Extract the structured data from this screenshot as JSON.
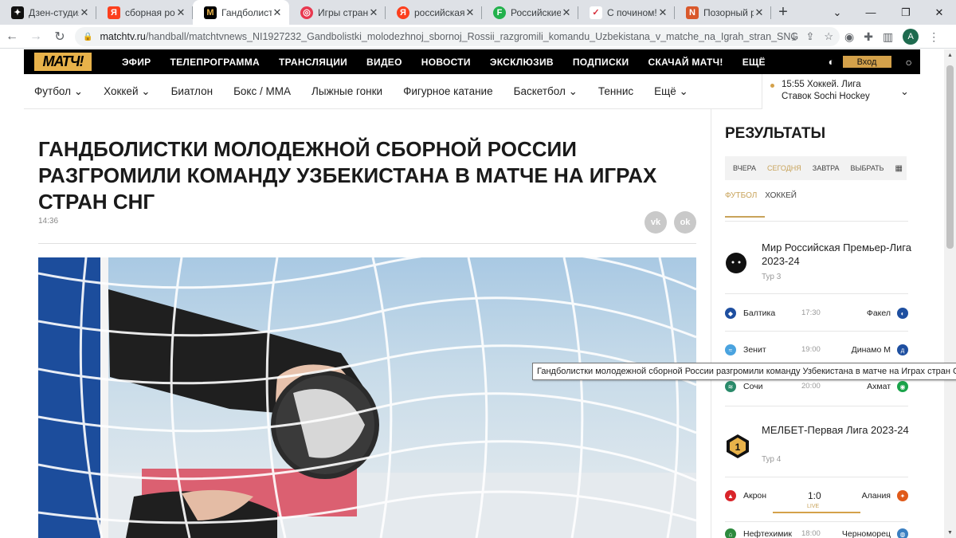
{
  "browser": {
    "tabs": [
      {
        "title": "Дзен-студия",
        "icon": "dzen-icon",
        "color": "#111111"
      },
      {
        "title": "сборная рос",
        "icon": "yandex-icon",
        "color": "#fc3f1d"
      },
      {
        "title": "Гандболистк",
        "icon": "match-tv-icon",
        "color": "#000000",
        "active": true
      },
      {
        "title": "Игры стран С",
        "icon": "sport-site-icon",
        "color": "#e8384f"
      },
      {
        "title": "российская с",
        "icon": "yandex-icon",
        "color": "#fc3f1d"
      },
      {
        "title": "Российские",
        "icon": "f-site-icon",
        "color": "#22b14c"
      },
      {
        "title": "С почином!",
        "icon": "sport-site-icon",
        "color": "#d62d3a"
      },
      {
        "title": "Позорный р",
        "icon": "news-site-icon",
        "color": "#d9582b"
      }
    ],
    "url_host": "matchtv.ru",
    "url_path": "/handball/matchtvnews_NI1927232_Gandbolistki_molodezhnoj_sbornoj_Rossii_razgromili_komandu_Uzbekistana_v_matche_na_Igrah_stran_SNG",
    "profile_initial": "A"
  },
  "site": {
    "logo": "МАТЧ!",
    "nav": [
      "ЭФИР",
      "ТЕЛЕПРОГРАММА",
      "ТРАНСЛЯЦИИ",
      "ВИДЕО",
      "НОВОСТИ",
      "ЭКСКЛЮЗИВ",
      "ПОДПИСКИ",
      "СКАЧАЙ МАТЧ!",
      "ЕЩЁ"
    ],
    "login": "Вход",
    "sports": [
      "Футбол",
      "Хоккей",
      "Биатлон",
      "Бокс / ММА",
      "Лыжные гонки",
      "Фигурное катание",
      "Баскетбол",
      "Теннис",
      "Ещё"
    ],
    "live_line1": "15:55 Хоккей. Лига",
    "live_line2": "Ставок Sochi Hockey"
  },
  "article": {
    "headline": "Гандболистки молодежной сборной России разгромили команду Узбекистана в матче на Играх стран СНГ",
    "time": "14:36",
    "share_vk": "vk",
    "share_ok": "ok"
  },
  "results": {
    "title": "РЕЗУЛЬТАТЫ",
    "days": [
      "ВЧЕРА",
      "СЕГОДНЯ",
      "ЗАВТРА",
      "ВЫБРАТЬ"
    ],
    "sports": [
      "ФУТБОЛ",
      "ХОККЕЙ"
    ],
    "league1": {
      "name": "Мир Российская Премьер-Лига 2023-24",
      "round": "Тур 3"
    },
    "matches1": [
      {
        "home": "Балтика",
        "time": "17:30",
        "away": "Факел"
      },
      {
        "home": "Зенит",
        "time": "19:00",
        "away": "Динамо М"
      },
      {
        "home": "Сочи",
        "time": "20:00",
        "away": "Ахмат"
      }
    ],
    "league2": {
      "name": "МЕЛБЕТ-Первая Лига 2023-24",
      "round": "Тур 4"
    },
    "matches2": [
      {
        "home": "Акрон",
        "score": "1:0",
        "status": "LIVE",
        "away": "Алания"
      },
      {
        "home": "Нефтехимик",
        "time": "18:00",
        "away": "Черноморец"
      }
    ]
  },
  "tooltip": "Гандболистки молодежной сборной России разгромили команду Узбекистана в матче на Играх стран СНГ",
  "colors": {
    "accent": "#d4a14a",
    "nav_bg": "#000000"
  }
}
